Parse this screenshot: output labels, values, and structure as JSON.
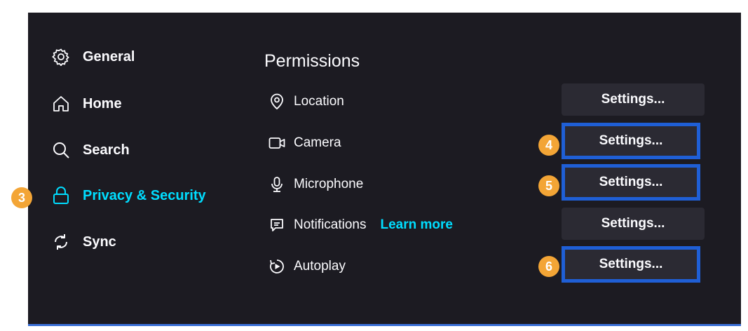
{
  "sidebar": {
    "items": [
      {
        "label": "General",
        "icon": "gear-icon"
      },
      {
        "label": "Home",
        "icon": "home-icon"
      },
      {
        "label": "Search",
        "icon": "search-icon"
      },
      {
        "label": "Privacy & Security",
        "icon": "lock-icon",
        "active": true,
        "badge": "3"
      },
      {
        "label": "Sync",
        "icon": "sync-icon"
      }
    ]
  },
  "permissions": {
    "title": "Permissions",
    "learn_more": "Learn more",
    "rows": [
      {
        "label": "Location",
        "icon": "location-icon",
        "button": "Settings..."
      },
      {
        "label": "Camera",
        "icon": "camera-icon",
        "button": "Settings...",
        "badge": "4"
      },
      {
        "label": "Microphone",
        "icon": "microphone-icon",
        "button": "Settings...",
        "badge": "5"
      },
      {
        "label": "Notifications",
        "icon": "notifications-icon",
        "button": "Settings..."
      },
      {
        "label": "Autoplay",
        "icon": "autoplay-icon",
        "button": "Settings...",
        "badge": "6"
      }
    ]
  },
  "colors": {
    "background": "#1c1b22",
    "accent": "#00ddff",
    "badge": "#f3a536",
    "highlight_border": "#1f5fd6"
  }
}
